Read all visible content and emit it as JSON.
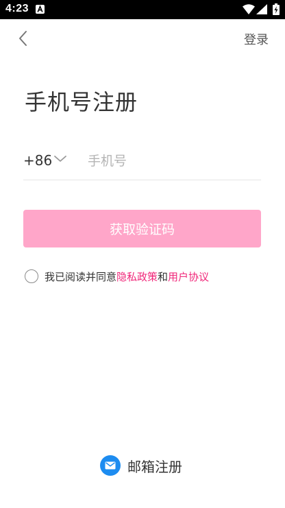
{
  "status_bar": {
    "time": "4:23",
    "notification_icon": "a-icon",
    "wifi_icon": "wifi-icon",
    "signal_icon": "signal-icon",
    "battery_icon": "battery-charging-icon"
  },
  "nav": {
    "back_icon": "chevron-left-icon",
    "login_label": "登录"
  },
  "title": "手机号注册",
  "phone": {
    "country_code": "+86",
    "dropdown_icon": "chevron-down-icon",
    "placeholder": "手机号",
    "value": ""
  },
  "get_code_button": {
    "label": "获取验证码",
    "color": "#ffa6c9"
  },
  "agreement": {
    "checked": false,
    "prefix": "我已阅读并同意",
    "privacy_link": "隐私政策",
    "and": "和",
    "terms_link": "用户协议",
    "link_color": "#f0287a"
  },
  "email_register": {
    "icon": "mail-icon",
    "icon_color": "#1d8cf0",
    "label": "邮箱注册"
  }
}
